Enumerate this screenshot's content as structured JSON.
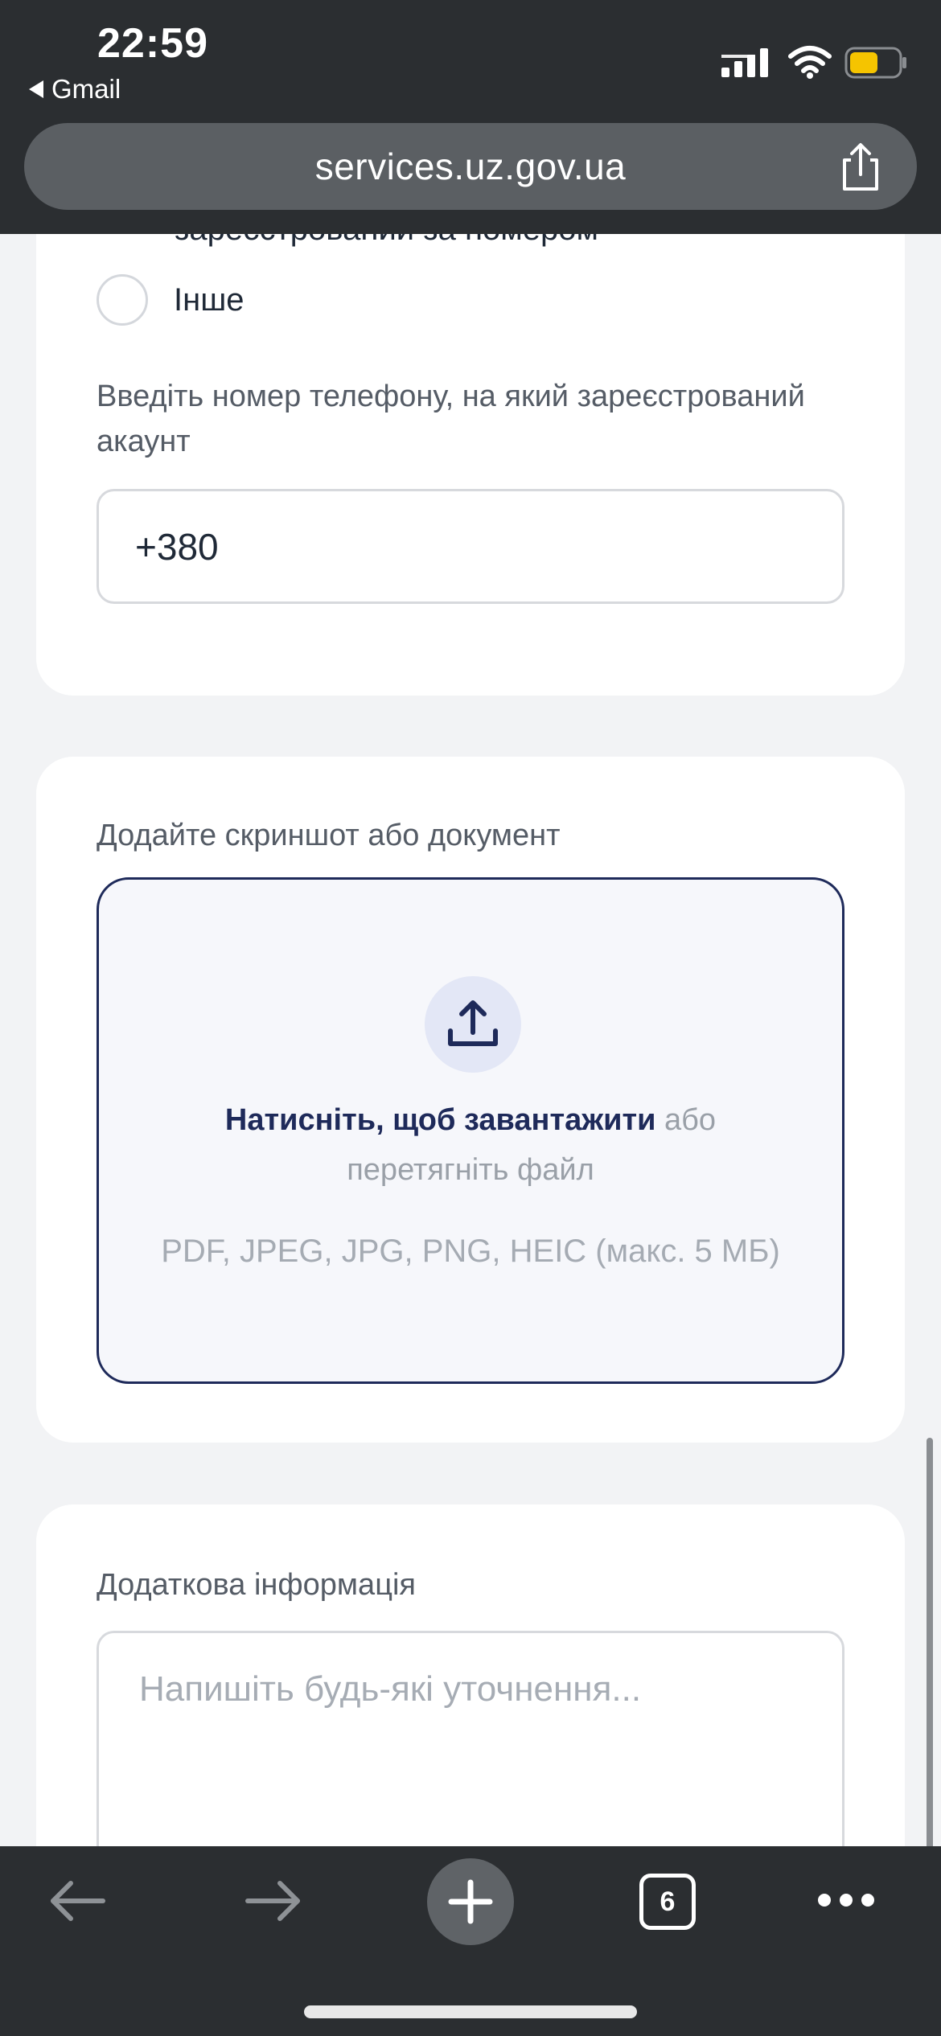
{
  "status_bar": {
    "time": "22:59",
    "back_app": "Gmail",
    "icons": [
      "cellular-signal-icon",
      "wifi-icon",
      "battery-icon"
    ]
  },
  "browser": {
    "url": "services.uz.gov.ua",
    "share_icon": "share-icon"
  },
  "form": {
    "partial_option": "зареєстрований за номером",
    "other_option": "Інше",
    "phone_caption": "Введіть номер телефону, на який зареєстрований акаунт",
    "phone_value": "+380",
    "upload_caption": "Додайте скриншот або документ",
    "upload_action": "Натисніть, щоб завантажити",
    "upload_or": "або",
    "upload_drag": "перетягніть файл",
    "upload_formats": "PDF, JPEG, JPG, PNG, HEIC (макс. 5 МБ)",
    "extra_caption": "Додаткова інформація",
    "extra_placeholder": "Напишіть будь-які уточнення..."
  },
  "toolbar": {
    "tab_count": "6"
  },
  "colors": {
    "chrome_bg": "#2b2e31",
    "url_bar": "#5b5f63",
    "accent_navy": "#1e2a5a",
    "page_bg": "#f2f3f5",
    "battery_fill": "#f5c400"
  }
}
